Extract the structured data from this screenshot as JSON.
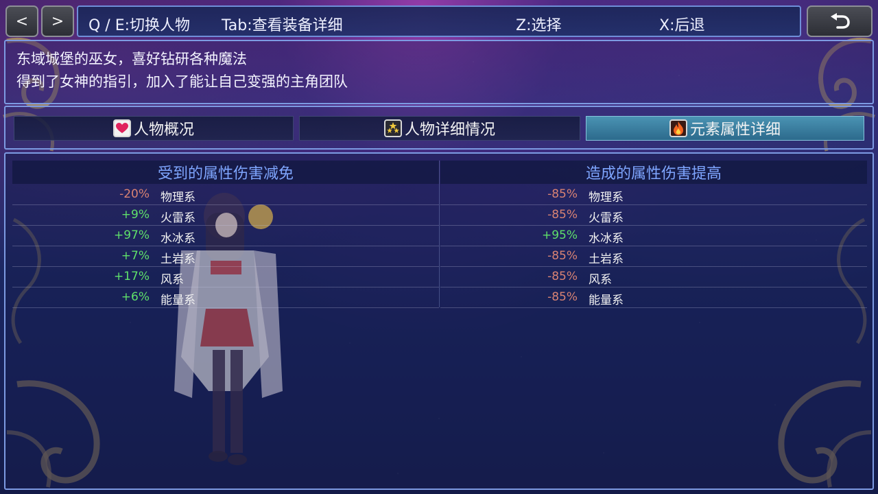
{
  "topbar": {
    "prev_label": "<",
    "next_label": ">",
    "hint_switch": "Q / E:切换人物",
    "hint_tab": "Tab:查看装备详细",
    "hint_select": "Z:选择",
    "hint_back": "X:后退",
    "back_icon": "return-arrow-icon"
  },
  "description": {
    "line1": "东域城堡的巫女，喜好钻研各种魔法",
    "line2": "得到了女神的指引，加入了能让自己变强的主角团队"
  },
  "tabs": [
    {
      "label": "人物概况",
      "icon": "heart-icon",
      "active": false
    },
    {
      "label": "人物详细情况",
      "icon": "stars-icon",
      "active": false
    },
    {
      "label": "元素属性详细",
      "icon": "fire-icon",
      "active": true
    }
  ],
  "resistance": {
    "title": "受到的属性伤害减免",
    "rows": [
      {
        "value": "-20%",
        "name": "物理系"
      },
      {
        "value": "+9%",
        "name": "火雷系"
      },
      {
        "value": "+97%",
        "name": "水冰系"
      },
      {
        "value": "+7%",
        "name": "土岩系"
      },
      {
        "value": "+17%",
        "name": "风系"
      },
      {
        "value": "+6%",
        "name": "能量系"
      }
    ]
  },
  "damage": {
    "title": "造成的属性伤害提高",
    "rows": [
      {
        "value": "-85%",
        "name": "物理系"
      },
      {
        "value": "-85%",
        "name": "火雷系"
      },
      {
        "value": "+95%",
        "name": "水冰系"
      },
      {
        "value": "-85%",
        "name": "土岩系"
      },
      {
        "value": "-85%",
        "name": "风系"
      },
      {
        "value": "-85%",
        "name": "能量系"
      }
    ]
  },
  "colors": {
    "positive": "#5fe06a",
    "negative": "#d98373",
    "header_text": "#7fa6ff",
    "panel_border": "#7d9be3",
    "active_tab": "#3d87a8"
  }
}
